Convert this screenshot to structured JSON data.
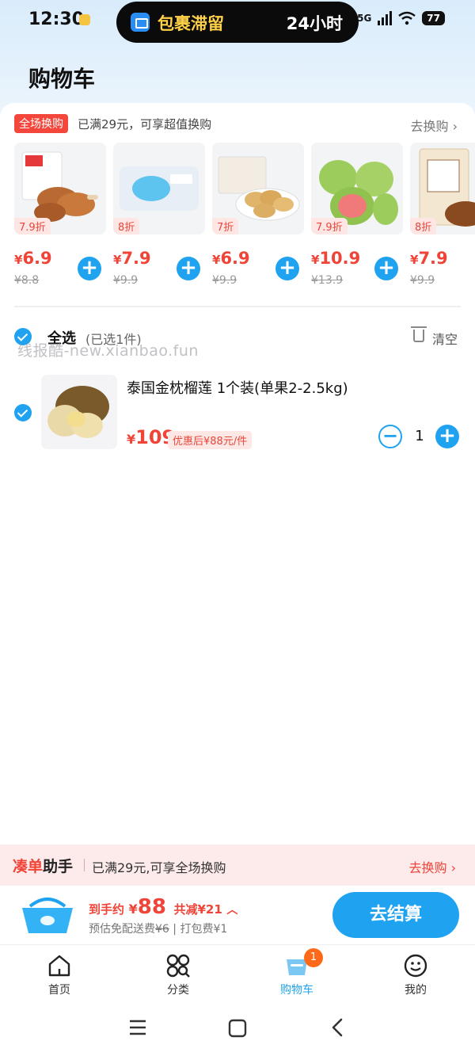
{
  "status_bar": {
    "time": "12:30",
    "island_text": "包裹滞留",
    "island_right": "24小时",
    "network": "5G",
    "battery": "77"
  },
  "page_title": "购物车",
  "promo": {
    "tag": "全场换购",
    "desc": "已满29元，可享超值换购",
    "go_label": "去换购"
  },
  "products": [
    {
      "discount": "7.9折",
      "yen": "¥",
      "price": "6.9",
      "orig": "¥8.8",
      "icon": "braised-chicken-leg-image"
    },
    {
      "discount": "8折",
      "yen": "¥",
      "price": "7.9",
      "orig": "¥9.9",
      "icon": "wet-wipes-image"
    },
    {
      "discount": "7折",
      "yen": "¥",
      "price": "6.9",
      "orig": "¥9.9",
      "icon": "dumplings-image"
    },
    {
      "discount": "7.9折",
      "yen": "¥",
      "price": "10.9",
      "orig": "¥13.9",
      "icon": "guava-image"
    },
    {
      "discount": "8折",
      "yen": "¥",
      "price": "7.9",
      "orig": "¥9.9",
      "icon": "beef-tofu-snack-image"
    }
  ],
  "select_all": {
    "label": "全选",
    "count": "(已选1件)",
    "clear": "清空"
  },
  "watermark": "线报酷-new.xianbao.fun",
  "cart_item": {
    "title": "泰国金枕榴莲 1个装(单果2-2.5kg)",
    "yen": "¥",
    "price": "109",
    "after_discount": "优惠后¥88元/件",
    "qty": "1"
  },
  "helper": {
    "title_red": "凑单",
    "title_dark": "助手",
    "desc": "已满29元,可享全场换购",
    "go_label": "去换购"
  },
  "checkout": {
    "label": "到手约",
    "yen": "¥",
    "amount": "88",
    "savings": "共减¥21",
    "shipping_prefix": "预估免配送费",
    "shipping_orig": "¥6",
    "packing": "打包费¥1",
    "pay_label": "去结算"
  },
  "tabs": [
    {
      "label": "首页",
      "icon": "home-icon"
    },
    {
      "label": "分类",
      "icon": "category-icon"
    },
    {
      "label": "购物车",
      "icon": "cart-icon",
      "badge": "1"
    },
    {
      "label": "我的",
      "icon": "profile-icon"
    }
  ],
  "colors": {
    "accent": "#1fa3f0",
    "price": "#f04438",
    "badge": "#ff6a1a"
  }
}
